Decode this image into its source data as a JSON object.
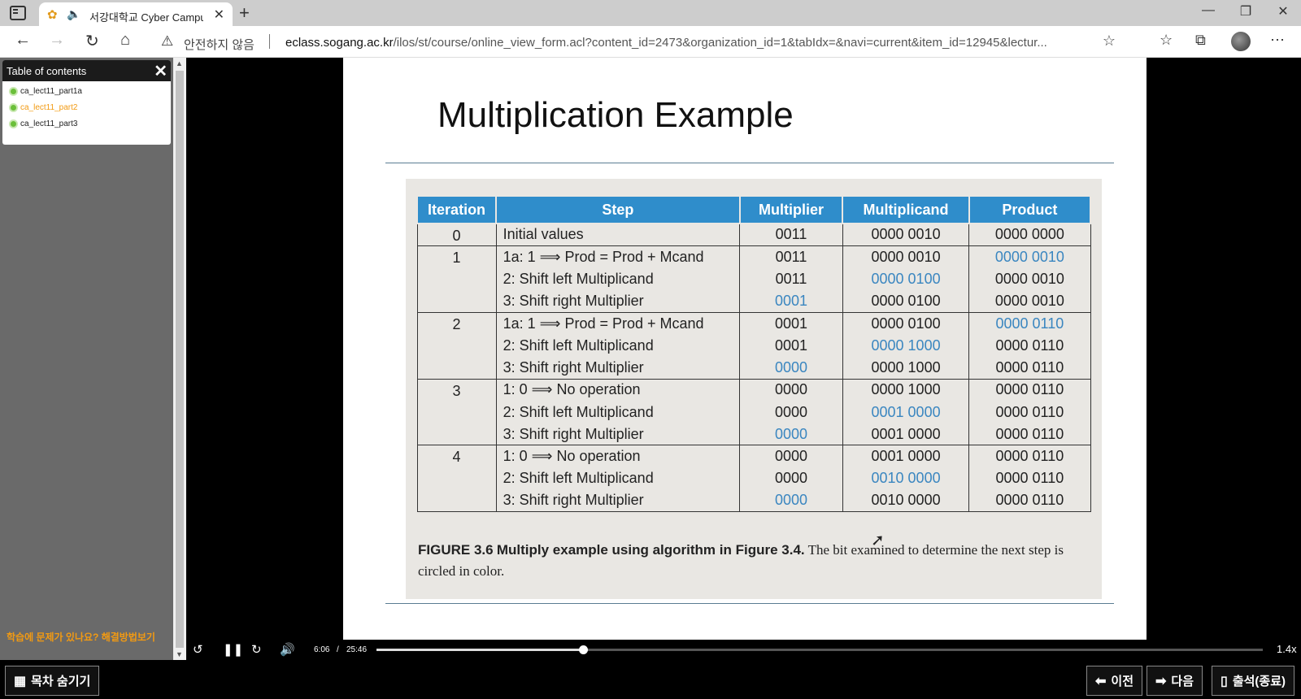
{
  "browser": {
    "tab_title": "서강대학교 Cyber Campus",
    "security_warning": "안전하지 않음",
    "url_domain": "eclass.sogang.ac.kr",
    "url_path": "/ilos/st/course/online_view_form.acl?content_id=2473&organization_id=1&tabIdx=&navi=current&item_id=12945&lectur..."
  },
  "toc": {
    "title": "Table of contents",
    "items": [
      "ca_lect11_part1a",
      "ca_lect11_part2",
      "ca_lect11_part3"
    ],
    "active_index": 1
  },
  "help_link": "학습에 문제가 있나요? 해결방법보기",
  "slide": {
    "title": "Multiplication Example",
    "headers": [
      "Iteration",
      "Step",
      "Multiplier",
      "Multiplicand",
      "Product"
    ],
    "rows": [
      {
        "iter": "0",
        "step": "Initial values",
        "multiplier": "0011",
        "multiplicand": "0000 0010",
        "product": "0000 0000",
        "hl": ""
      },
      {
        "iter": "1",
        "step": "1a: 1 ⟹ Prod = Prod + Mcand",
        "multiplier": "0011",
        "multiplicand": "0000 0010",
        "product": "0000 0010",
        "hl": "product"
      },
      {
        "iter": "",
        "step": "2: Shift left Multiplicand",
        "multiplier": "0011",
        "multiplicand": "0000 0100",
        "product": "0000 0010",
        "hl": "multiplicand"
      },
      {
        "iter": "",
        "step": "3: Shift right Multiplier",
        "multiplier": "0001",
        "multiplicand": "0000 0100",
        "product": "0000 0010",
        "hl": "multiplier"
      },
      {
        "iter": "2",
        "step": "1a: 1 ⟹ Prod = Prod + Mcand",
        "multiplier": "0001",
        "multiplicand": "0000 0100",
        "product": "0000 0110",
        "hl": "product"
      },
      {
        "iter": "",
        "step": "2: Shift left Multiplicand",
        "multiplier": "0001",
        "multiplicand": "0000 1000",
        "product": "0000 0110",
        "hl": "multiplicand"
      },
      {
        "iter": "",
        "step": "3: Shift right Multiplier",
        "multiplier": "0000",
        "multiplicand": "0000 1000",
        "product": "0000 0110",
        "hl": "multiplier"
      },
      {
        "iter": "3",
        "step": "1: 0 ⟹ No operation",
        "multiplier": "0000",
        "multiplicand": "0000 1000",
        "product": "0000 0110",
        "hl": ""
      },
      {
        "iter": "",
        "step": "2: Shift left Multiplicand",
        "multiplier": "0000",
        "multiplicand": "0001 0000",
        "product": "0000 0110",
        "hl": "multiplicand"
      },
      {
        "iter": "",
        "step": "3: Shift right Multiplier",
        "multiplier": "0000",
        "multiplicand": "0001 0000",
        "product": "0000 0110",
        "hl": "multiplier"
      },
      {
        "iter": "4",
        "step": "1: 0 ⟹ No operation",
        "multiplier": "0000",
        "multiplicand": "0001 0000",
        "product": "0000 0110",
        "hl": ""
      },
      {
        "iter": "",
        "step": "2: Shift left Multiplicand",
        "multiplier": "0000",
        "multiplicand": "0010 0000",
        "product": "0000 0110",
        "hl": "multiplicand"
      },
      {
        "iter": "",
        "step": "3: Shift right Multiplier",
        "multiplier": "0000",
        "multiplicand": "0010 0000",
        "product": "0000 0110",
        "hl": "multiplier"
      }
    ],
    "caption_fig": "FIGURE 3.6",
    "caption_bold": "Multiply example using algorithm in Figure 3.4.",
    "caption_text": "The bit examined to determine the next step is circled in color."
  },
  "player": {
    "current_time": "6:06",
    "separator": "/",
    "duration": "25:46",
    "progress": 0.233,
    "speed": "1.4x"
  },
  "bottom": {
    "toc_toggle": "목차 숨기기",
    "prev": "이전",
    "next": "다음",
    "exit": "출석(종료)"
  },
  "colors": {
    "accent": "#f29a12",
    "table_header": "#2f8dcb",
    "highlight": "#3a86c0"
  }
}
